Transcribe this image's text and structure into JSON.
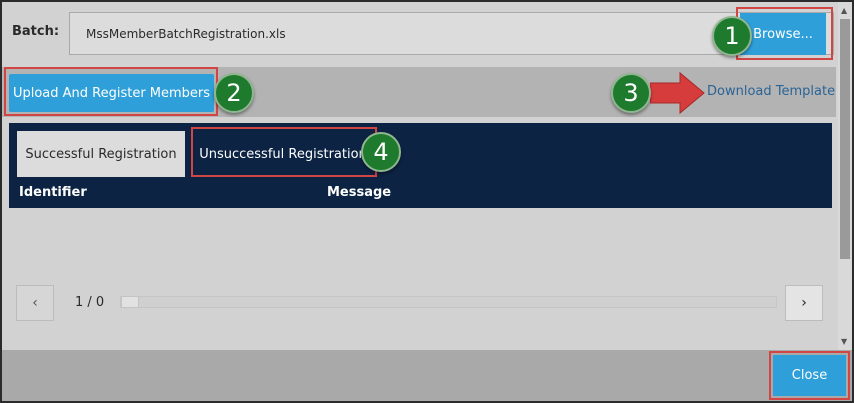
{
  "batch": {
    "label": "Batch:",
    "file_name": "MssMemberBatchRegistration.xls",
    "browse_label": "Browse..."
  },
  "actions": {
    "upload_label": "Upload And Register Members",
    "download_label": "Download Template"
  },
  "tabs": [
    {
      "label": "Successful Registration"
    },
    {
      "label": "Unsuccessful Registration"
    }
  ],
  "columns": [
    "Identifier",
    "Message"
  ],
  "pager": {
    "prev_icon": "chevron-left-icon",
    "next_icon": "chevron-right-icon",
    "prev_symbol": "‹",
    "next_symbol": "›",
    "page_text": "1 / 0"
  },
  "callouts": [
    "1",
    "2",
    "3",
    "4"
  ],
  "footer": {
    "close_label": "Close"
  },
  "colors": {
    "accent": "#2e9fd8",
    "panel": "#0c2344",
    "badge": "#1e7a2c",
    "highlight": "#d24545",
    "link": "#2a6496"
  }
}
